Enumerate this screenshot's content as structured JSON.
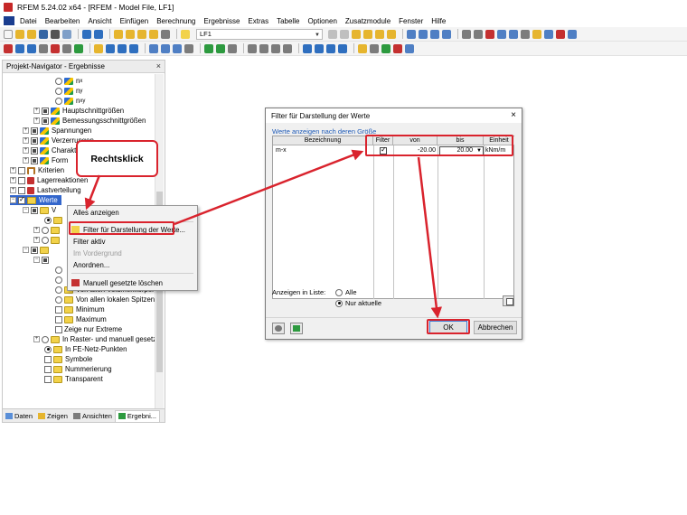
{
  "window": {
    "title": "RFEM 5.24.02 x64 - [RFEM - Model File, LF1]"
  },
  "menu": [
    "Datei",
    "Bearbeiten",
    "Ansicht",
    "Einfügen",
    "Berechnung",
    "Ergebnisse",
    "Extras",
    "Tabelle",
    "Optionen",
    "Zusatzmodule",
    "Fenster",
    "Hilfe"
  ],
  "toolbar": {
    "loadcase_value": "LF1"
  },
  "navigator": {
    "title": "Projekt-Navigator - Ergebnisse",
    "tree": {
      "nx": "n",
      "nx_sub": "x",
      "ny": "n",
      "ny_sub": "y",
      "nxy": "n",
      "nxy_sub": "xy",
      "haupt": "Hauptschnittgrößen",
      "bemessung": "Bemessungsschnittgrößen",
      "spannungen": "Spannungen",
      "verzerrungen": "Verzerrungen",
      "charakter": "Charakteri",
      "form": "Form",
      "kriterien": "Kriterien",
      "lagerreaktionen": "Lagerreaktionen",
      "lastverteilung": "Lastverteilung",
      "werte": "Werte",
      "w_short": "V",
      "volumen": "Von allen Volumenkörpern",
      "spitzen": "Von allen lokalen Spitzenw",
      "minimum": "Minimum",
      "maximum": "Maximum",
      "extreme": "Zeige nur Extreme",
      "raster": "In Raster- und manuell gesetz",
      "fenetz": "In FE-Netz-Punkten",
      "symbole": "Symbole",
      "nummerierung": "Nummerierung",
      "transparent": "Transparent"
    },
    "tabs": [
      "Daten",
      "Zeigen",
      "Ansichten",
      "Ergebni..."
    ]
  },
  "context_menu": {
    "items": {
      "alles": "Alles anzeigen",
      "filter": "Filter für Darstellung der Werte...",
      "aktiv": "Filter aktiv",
      "vordergrund": "Im Vordergrund",
      "anordnen": "Anordnen...",
      "loeschen": "Manuell gesetzte löschen"
    }
  },
  "callout": {
    "text": "Rechtsklick"
  },
  "dialog": {
    "title": "Filter für Darstellung der Werte",
    "group_label": "Werte anzeigen nach deren Größe",
    "columns": {
      "bezeichnung": "Bezeichnung",
      "filter": "Filter",
      "von": "von",
      "bis": "bis",
      "einheit": "Einheit"
    },
    "row": {
      "bezeichnung": "m-x",
      "von": "-20.00",
      "bis": "20.00",
      "einheit": "kNm/m"
    },
    "list_label": "Anzeigen in Liste:",
    "radio_alle": "Alle",
    "radio_aktuelle": "Nur aktuelle",
    "ok": "OK",
    "cancel": "Abbrechen"
  },
  "colors": {
    "highlight": "#d9232d",
    "link_blue": "#1f5bb8"
  }
}
